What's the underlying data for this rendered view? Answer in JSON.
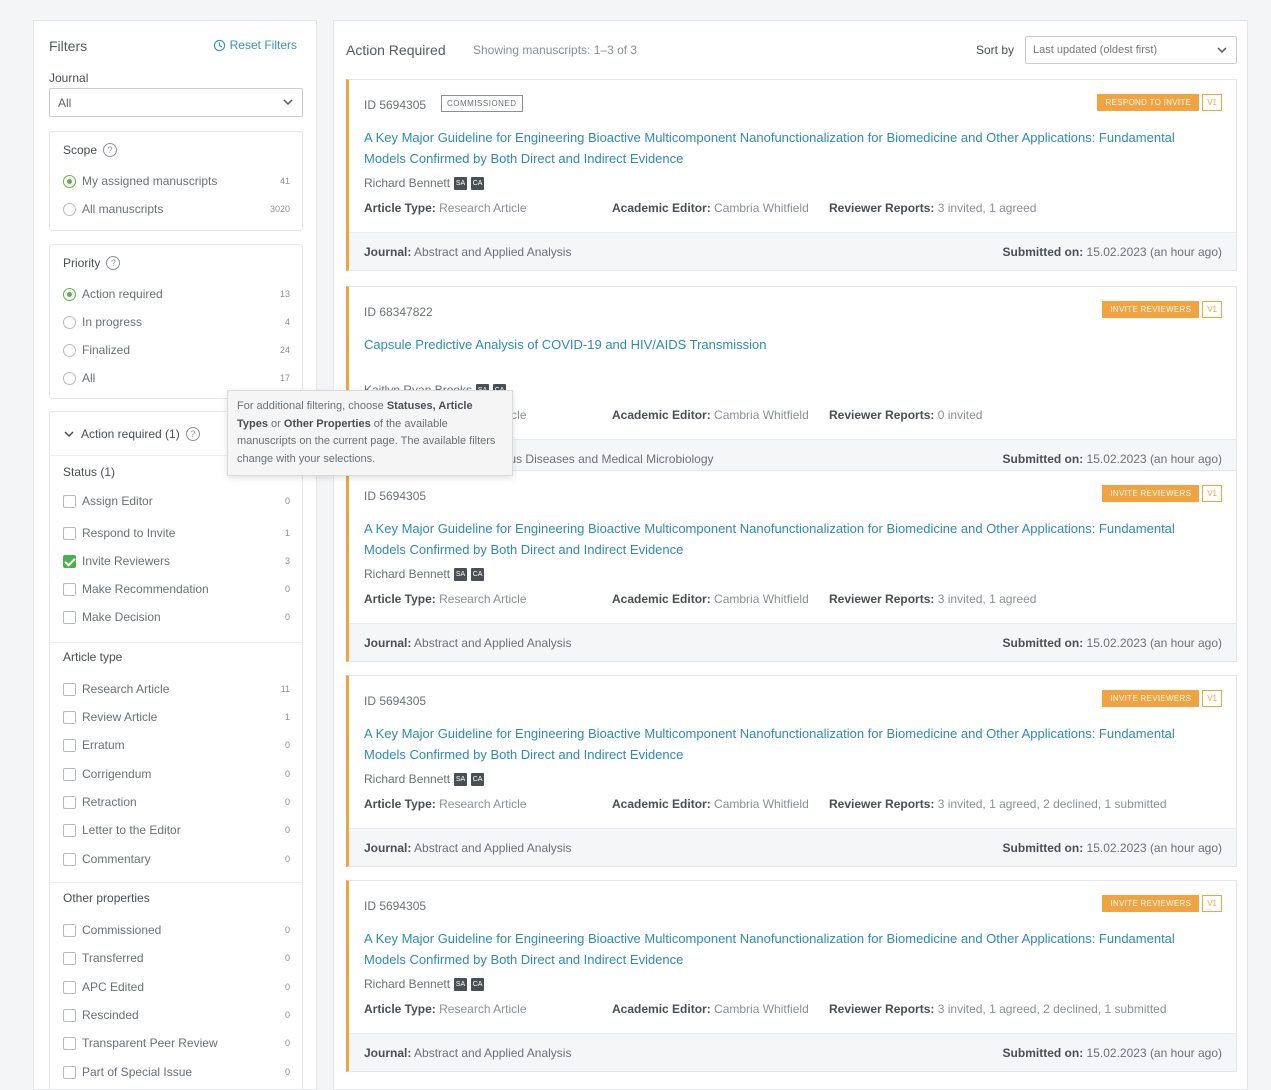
{
  "sidebar": {
    "title": "Filters",
    "reset_label": "Reset Filters",
    "journal_label": "Journal",
    "journal_value": "All",
    "scope": {
      "title": "Scope",
      "options": [
        {
          "label": "My assigned manuscripts",
          "count": "41",
          "selected": true
        },
        {
          "label": "All manuscripts",
          "count": "3020",
          "selected": false
        }
      ]
    },
    "priority": {
      "title": "Priority",
      "options": [
        {
          "label": "Action required",
          "count": "13",
          "selected": true
        },
        {
          "label": "In progress",
          "count": "4",
          "selected": false
        },
        {
          "label": "Finalized",
          "count": "24",
          "selected": false
        },
        {
          "label": "All",
          "count": "17",
          "selected": false
        }
      ]
    },
    "action_required": {
      "title": "Action required (1)",
      "status_title": "Status (1)",
      "statuses": [
        {
          "label": "Assign Editor",
          "count": "0",
          "checked": false
        },
        {
          "label": "Respond to Invite",
          "count": "1",
          "checked": false
        },
        {
          "label": "Invite Reviewers",
          "count": "3",
          "checked": true
        },
        {
          "label": "Make Recommendation",
          "count": "0",
          "checked": false
        },
        {
          "label": "Make Decision",
          "count": "0",
          "checked": false
        }
      ],
      "article_type_title": "Article type",
      "article_types": [
        {
          "label": "Research Article",
          "count": "11"
        },
        {
          "label": "Review Article",
          "count": "1"
        },
        {
          "label": "Erratum",
          "count": "0"
        },
        {
          "label": "Corrigendum",
          "count": "0"
        },
        {
          "label": "Retraction",
          "count": "0"
        },
        {
          "label": "Letter to the Editor",
          "count": "0"
        },
        {
          "label": "Commentary",
          "count": "0"
        }
      ],
      "other_title": "Other properties",
      "other_properties": [
        {
          "label": "Commissioned",
          "count": "0"
        },
        {
          "label": "Transferred",
          "count": "0"
        },
        {
          "label": "APC Edited",
          "count": "0"
        },
        {
          "label": "Rescinded",
          "count": "0"
        },
        {
          "label": "Transparent Peer Review",
          "count": "0"
        },
        {
          "label": "Part of Special Issue",
          "count": "0"
        }
      ]
    },
    "tooltip": {
      "t1": "For additional filtering, choose ",
      "b1": "Statuses, Article Types",
      "t2": " or ",
      "b2": "Other Properties",
      "t3": " of the available manuscripts on the current page. The available filters change with your selections."
    }
  },
  "main": {
    "title": "Action Required",
    "showing": "Showing manuscripts: 1–3 of 3",
    "sort_label": "Sort by",
    "sort_value": "Last updated (oldest first)",
    "labels": {
      "article_type": "Article Type:",
      "academic_editor": "Academic Editor:",
      "reviewer_reports": "Reviewer Reports:",
      "journal": "Journal:",
      "submitted": "Submitted on:"
    },
    "manuscripts": [
      {
        "id": "ID 5694305",
        "tag": "COMMISSIONED",
        "action": "RESPOND TO INVITE",
        "version": "V1",
        "title": "A Key Major Guideline for Engineering Bioactive Multicomponent Nanofunctionalization for Biomedicine and Other Applications: Fundamental Models Confirmed by Both Direct and Indirect Evidence",
        "authors": "Richard Bennett",
        "article_type": "Research Article",
        "editor": "Cambria Whitfield",
        "reports": "3 invited, 1 agreed",
        "journal": "Abstract and Applied Analysis",
        "submitted": "15.02.2023 (an hour ago)"
      },
      {
        "id": "ID 68347822",
        "tag": "",
        "action": "INVITE REVIEWERS",
        "version": "V1",
        "title": "Capsule Predictive Analysis of COVID-19 and HIV/AIDS Transmission",
        "authors": "Kaitlyn Ryan Brooks",
        "article_type": "Research Article",
        "editor": "Cambria Whitfield",
        "reports": "0 invited",
        "journal": "Journal of Infectious Diseases and Medical Microbiology",
        "submitted": "15.02.2023 (an hour ago)"
      },
      {
        "id": "ID 5694305",
        "tag": "",
        "action": "INVITE REVIEWERS",
        "version": "V1",
        "title": "A Key Major Guideline for Engineering Bioactive Multicomponent Nanofunctionalization for Biomedicine and Other Applications: Fundamental Models Confirmed by Both Direct and Indirect Evidence",
        "authors": "Richard Bennett",
        "article_type": "Research Article",
        "editor": "Cambria Whitfield",
        "reports": "3 invited, 1 agreed",
        "journal": "Abstract and Applied Analysis",
        "submitted": "15.02.2023 (an hour ago)"
      },
      {
        "id": "ID 5694305",
        "tag": "",
        "action": "INVITE REVIEWERS",
        "version": "V1",
        "title": "A Key Major Guideline for Engineering Bioactive Multicomponent Nanofunctionalization for Biomedicine and Other Applications: Fundamental Models Confirmed by Both Direct and Indirect Evidence",
        "authors": "Richard Bennett",
        "article_type": "Research Article",
        "editor": "Cambria Whitfield",
        "reports": "3 invited, 1 agreed, 2 declined, 1 submitted",
        "journal": "Abstract and Applied Analysis",
        "submitted": "15.02.2023 (an hour ago)"
      },
      {
        "id": "ID 5694305",
        "tag": "",
        "action": "INVITE REVIEWERS",
        "version": "V1",
        "title": "A Key Major Guideline for Engineering Bioactive Multicomponent Nanofunctionalization for Biomedicine and Other Applications: Fundamental Models Confirmed by Both Direct and Indirect Evidence",
        "authors": "Richard Bennett",
        "article_type": "Research Article",
        "editor": "Cambria Whitfield",
        "reports": "3 invited, 1 agreed, 2 declined, 1 submitted",
        "journal": "Abstract and Applied Analysis",
        "submitted": "15.02.2023 (an hour ago)"
      }
    ]
  },
  "icons": {
    "author_badges": [
      "SA",
      "CA"
    ]
  },
  "colors": {
    "accent_orange": "#f2a340",
    "link_blue": "#2e8bb2",
    "check_green": "#4caf50"
  }
}
